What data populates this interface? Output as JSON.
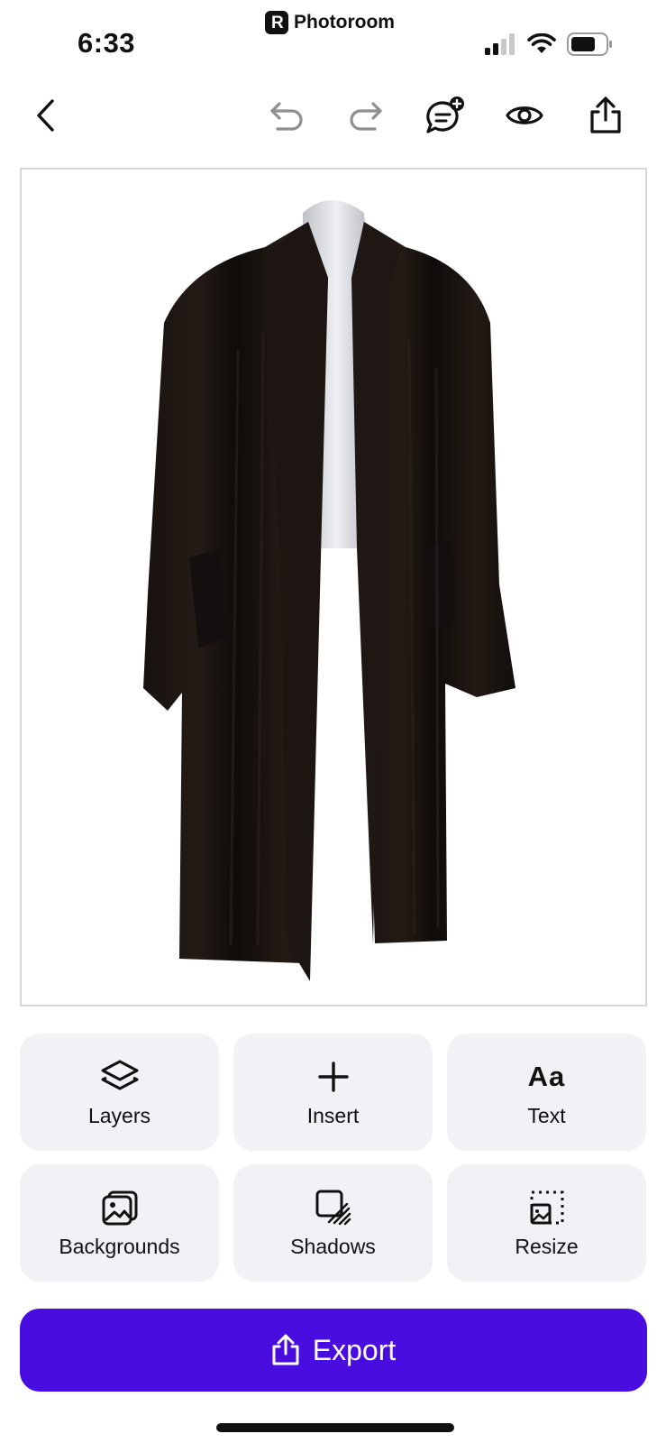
{
  "status_bar": {
    "time": "6:33",
    "app_name": "Photoroom"
  },
  "toolbar": {
    "icons": [
      "back-chevron-icon",
      "undo-icon",
      "redo-icon",
      "chat-add-icon",
      "eye-icon",
      "share-icon"
    ]
  },
  "canvas": {
    "subject": "coat-image"
  },
  "tools": [
    {
      "label": "Layers",
      "icon": "layers-icon"
    },
    {
      "label": "Insert",
      "icon": "plus-icon"
    },
    {
      "label": "Text",
      "icon": "text-aa-icon",
      "glyph": "Aa"
    },
    {
      "label": "Backgrounds",
      "icon": "backgrounds-icon"
    },
    {
      "label": "Shadows",
      "icon": "shadows-icon"
    },
    {
      "label": "Resize",
      "icon": "resize-icon"
    }
  ],
  "export": {
    "label": "Export",
    "color": "#4a0de0"
  }
}
